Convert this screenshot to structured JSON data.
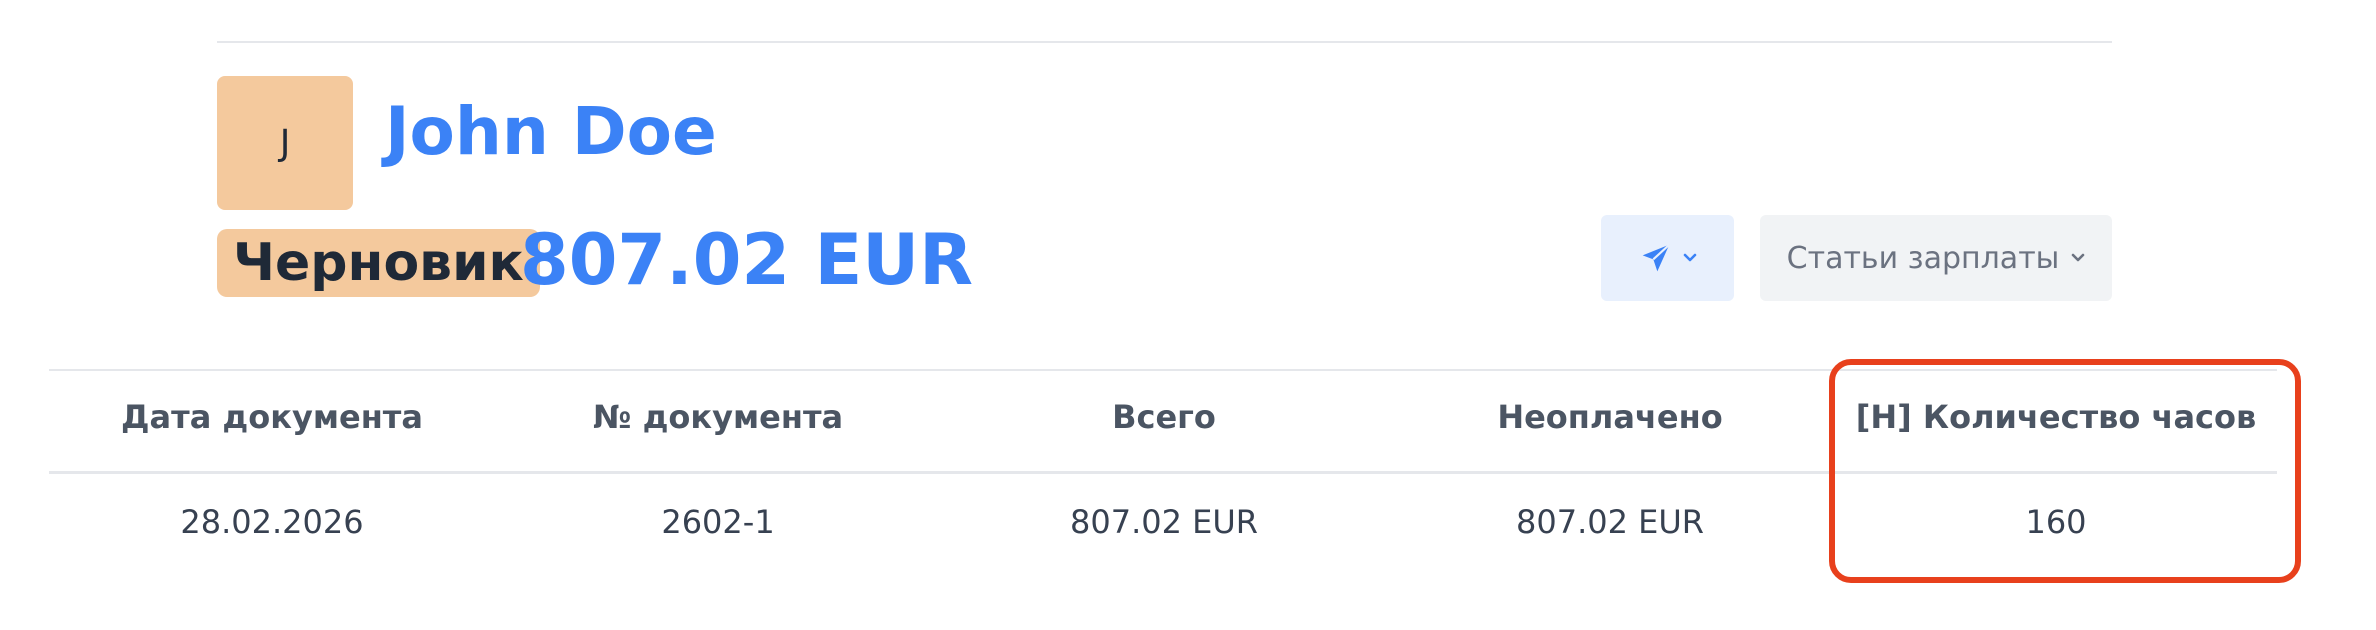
{
  "header": {
    "avatar_initial": "J",
    "name": "John Doe",
    "status": "Черновик",
    "amount": "807.02 EUR"
  },
  "toolbar": {
    "send_icon": "paper-plane-icon",
    "salary_items_label": "Статьи зарплаты"
  },
  "table": {
    "columns": [
      "Дата документа",
      "№ документа",
      "Всего",
      "Неоплачено",
      "[H] Количество часов"
    ],
    "rows": [
      [
        "28.02.2026",
        "2602-1",
        "807.02 EUR",
        "807.02 EUR",
        "160"
      ]
    ]
  },
  "colors": {
    "accent": "#3b82f6",
    "badge": "#f4c99d",
    "highlight": "#e8401c"
  }
}
